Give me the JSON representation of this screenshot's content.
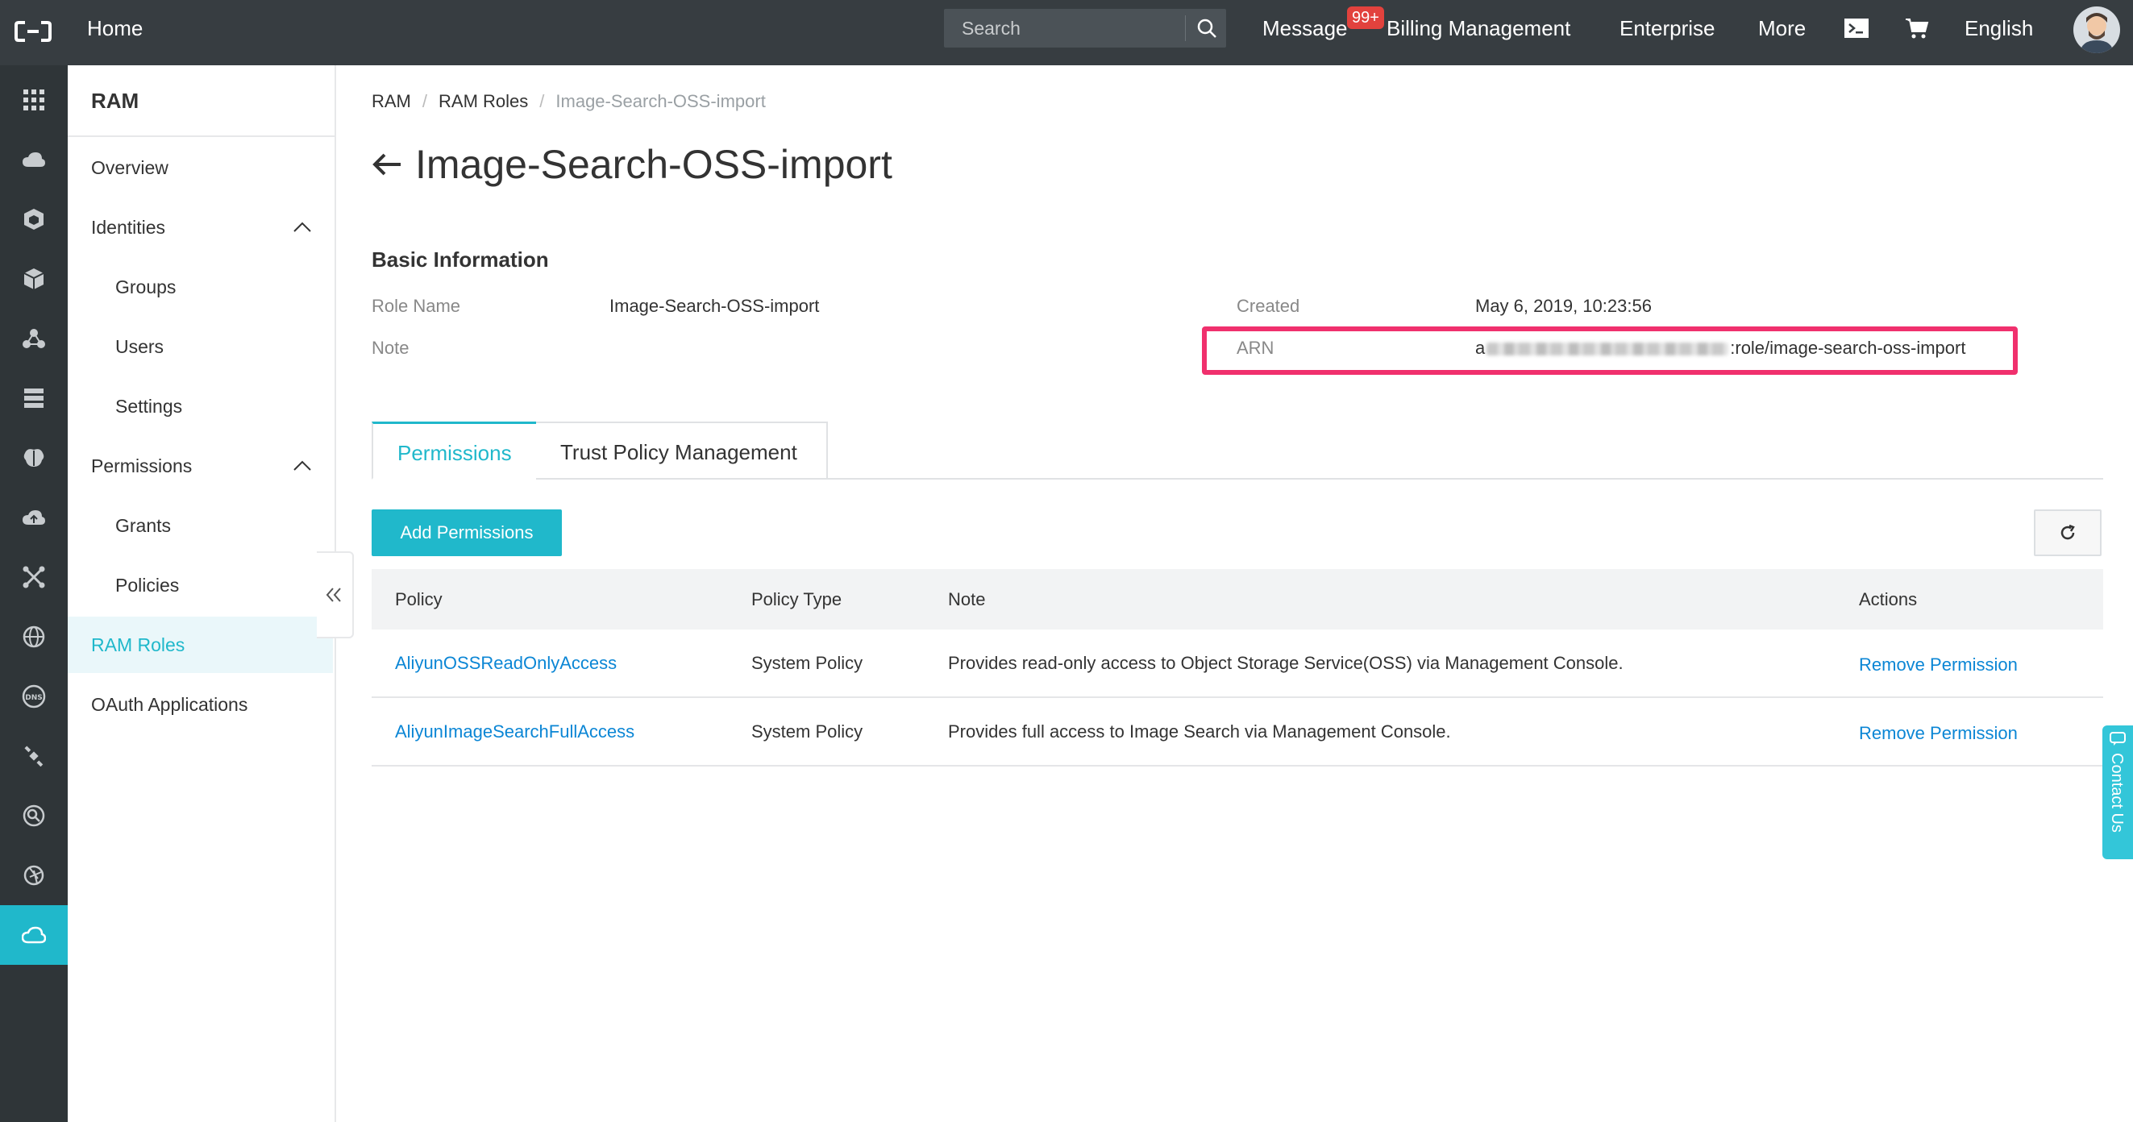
{
  "topbar": {
    "home": "Home",
    "search_placeholder": "Search",
    "message": "Message",
    "message_badge": "99+",
    "billing": "Billing Management",
    "enterprise": "Enterprise",
    "more": "More",
    "language": "English"
  },
  "rail": {
    "icons": [
      "grid-icon",
      "cloud-icon",
      "cube-icon",
      "cube-alt-icon",
      "nodes-icon",
      "server-icon",
      "brain-icon",
      "cloud-upload-icon",
      "network-icon",
      "globe-icon",
      "dns-icon",
      "satellite-icon",
      "search-scan-icon",
      "aperture-icon",
      "cloud-active-icon"
    ]
  },
  "sidebar": {
    "title": "RAM",
    "items": [
      {
        "label": "Overview"
      },
      {
        "label": "Identities"
      },
      {
        "label": "Groups"
      },
      {
        "label": "Users"
      },
      {
        "label": "Settings"
      },
      {
        "label": "Permissions"
      },
      {
        "label": "Grants"
      },
      {
        "label": "Policies"
      },
      {
        "label": "RAM Roles"
      },
      {
        "label": "OAuth Applications"
      }
    ]
  },
  "breadcrumb": [
    "RAM",
    "RAM Roles",
    "Image-Search-OSS-import"
  ],
  "page_title": "Image-Search-OSS-import",
  "basic_info": {
    "title": "Basic Information",
    "role_name_label": "Role Name",
    "role_name_value": "Image-Search-OSS-import",
    "note_label": "Note",
    "created_label": "Created",
    "created_value": "May 6, 2019, 10:23:56",
    "arn_label": "ARN",
    "arn_prefix": "a",
    "arn_suffix": ":role/image-search-oss-import"
  },
  "tabs": [
    "Permissions",
    "Trust Policy Management"
  ],
  "add_permissions": "Add Permissions",
  "table": {
    "headers": [
      "Policy",
      "Policy Type",
      "Note",
      "Actions"
    ],
    "rows": [
      {
        "policy": "AliyunOSSReadOnlyAccess",
        "type": "System Policy",
        "note": "Provides read-only access to Object Storage Service(OSS) via Management Console.",
        "action": "Remove Permission"
      },
      {
        "policy": "AliyunImageSearchFullAccess",
        "type": "System Policy",
        "note": "Provides full access to Image Search via Management Console.",
        "action": "Remove Permission"
      }
    ]
  },
  "contact_us": "Contact Us",
  "colors": {
    "topbar": "#373d41",
    "rail": "#2f3538",
    "accent": "#20b8cb",
    "link": "#0b86d5",
    "highlight": "#f0306d"
  }
}
